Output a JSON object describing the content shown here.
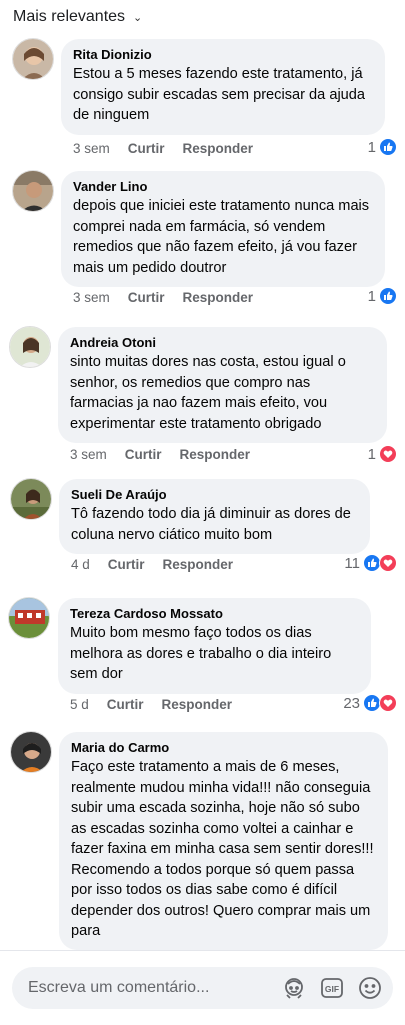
{
  "sort": {
    "label": "Mais relevantes"
  },
  "comments": [
    {
      "name": "Rita Dionizio",
      "text": "Estou a 5 meses fazendo este tratamento, já consigo subir escadas sem precisar da ajuda de ninguem",
      "time": "3 sem",
      "like": "Curtir",
      "reply": "Responder",
      "count": "1",
      "reactions": [
        "like"
      ]
    },
    {
      "name": "Vander Lino",
      "text": "depois que iniciei este tratamento nunca mais comprei nada em farmácia, só vendem remedios que não fazem efeito, já vou fazer mais um pedido doutror",
      "time": "3 sem",
      "like": "Curtir",
      "reply": "Responder",
      "count": "1",
      "reactions": [
        "like"
      ]
    },
    {
      "name": "Andreia Otoni",
      "text": "sinto muitas dores nas costa, estou igual o senhor, os remedios que compro nas farmacias ja nao fazem mais efeito, vou experimentar este tratamento obrigado",
      "time": "3 sem",
      "like": "Curtir",
      "reply": "Responder",
      "count": "1",
      "reactions": [
        "love"
      ]
    },
    {
      "name": "Sueli De Araújo",
      "text": "Tô fazendo todo dia já diminuir  as dores de coluna nervo ciático  muito bom",
      "time": "4 d",
      "like": "Curtir",
      "reply": "Responder",
      "count": "11",
      "reactions": [
        "like",
        "love"
      ]
    },
    {
      "name": "Tereza Cardoso Mossato",
      "text": "Muito bom mesmo faço todos os dias melhora as dores e trabalho o dia inteiro sem dor",
      "time": "5 d",
      "like": "Curtir",
      "reply": "Responder",
      "count": "23",
      "reactions": [
        "like",
        "love"
      ]
    },
    {
      "name": "Maria do Carmo",
      "text": "Faço este tratamento a mais de 6 meses, realmente mudou minha vida!!! não conseguia subir uma escada sozinha, hoje não só subo as escadas sozinha como voltei a cainhar e fazer faxina em minha casa sem sentir dores!!! Recomendo a todos porque só quem passa por isso todos os dias sabe como é difícil depender dos outros! Quero comprar mais um para"
    }
  ],
  "composer": {
    "placeholder": "Escreva um comentário...",
    "icons": [
      "avatar-sticker-icon",
      "gif-icon",
      "emoji-icon"
    ],
    "gif_label": "GIF"
  },
  "colors": {
    "like": "#1877f2",
    "love": "#f33e58",
    "bubble": "#f0f2f5",
    "meta": "#65676b"
  }
}
